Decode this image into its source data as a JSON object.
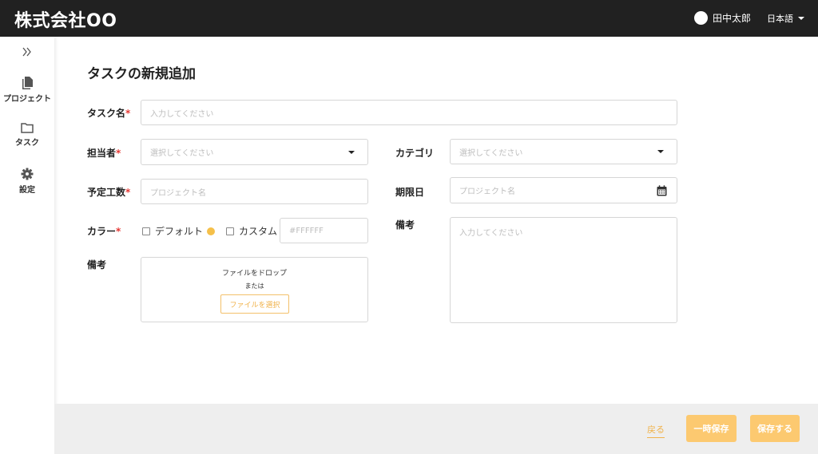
{
  "header": {
    "brand": "株式会社OO",
    "user_name": "田中太郎",
    "language": "日本語"
  },
  "sidebar": {
    "toggle_icon": "chevrons-right-icon",
    "items": [
      {
        "label": "プロジェクト",
        "icon": "file-icon"
      },
      {
        "label": "タスク",
        "icon": "folder-icon"
      },
      {
        "label": "設定",
        "icon": "gear-icon"
      }
    ]
  },
  "form": {
    "title": "タスクの新規追加",
    "required_mark": "*",
    "task_name": {
      "label": "タスク名",
      "placeholder": "入力してください"
    },
    "assignee": {
      "label": "担当者",
      "placeholder": "選択してください"
    },
    "category": {
      "label": "カテゴリ",
      "placeholder": "選択してください"
    },
    "estimate": {
      "label": "予定工数",
      "placeholder": "プロジェクト名"
    },
    "deadline": {
      "label": "期限日",
      "placeholder": "プロジェクト名",
      "icon": "calendar-icon"
    },
    "color": {
      "label": "カラー",
      "default_label": "デフォルト",
      "default_color": "#f5c04a",
      "custom_label": "カスタム",
      "custom_placeholder": "#FFFFFF"
    },
    "attachment": {
      "label": "備考",
      "drop_text": "ファイルをドロップ",
      "or_text": "または",
      "select_button": "ファイルを選択"
    },
    "notes": {
      "label": "備考",
      "placeholder": "入力してください"
    }
  },
  "footer": {
    "back_label": "戻る",
    "draft_label": "一時保存",
    "save_label": "保存する"
  },
  "colors": {
    "header_bg": "#212121",
    "accent": "#fcc970",
    "footer_bg": "#eeeeee",
    "required": "#e53935"
  }
}
